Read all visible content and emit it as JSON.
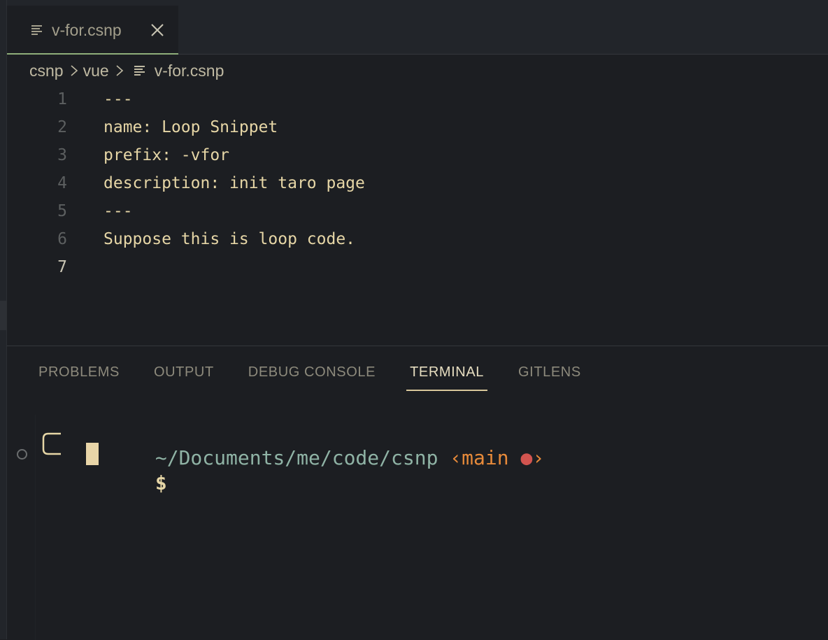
{
  "tab": {
    "label": "v-for.csnp",
    "file_icon": "lines-file-icon",
    "close_icon": "close-icon"
  },
  "breadcrumb": {
    "items": [
      "csnp",
      "vue",
      "v-for.csnp"
    ]
  },
  "editor": {
    "lines": [
      {
        "num": "1",
        "text": "---"
      },
      {
        "num": "2",
        "text": "name: Loop Snippet"
      },
      {
        "num": "3",
        "text": "prefix: -vfor"
      },
      {
        "num": "4",
        "text": "description: init taro page"
      },
      {
        "num": "5",
        "text": "---"
      },
      {
        "num": "6",
        "text": "Suppose this is loop code."
      },
      {
        "num": "7",
        "text": ""
      }
    ],
    "current_line": 7
  },
  "panel": {
    "tabs": [
      "PROBLEMS",
      "OUTPUT",
      "DEBUG CONSOLE",
      "TERMINAL",
      "GITLENS"
    ],
    "active_tab": "TERMINAL"
  },
  "terminal": {
    "path": "~/Documents/me/code/csnp",
    "branch_open": "‹",
    "branch": "main",
    "dirty_indicator": "●",
    "branch_close": "›",
    "prompt_symbol": "$"
  },
  "colors": {
    "background": "#1c1e22",
    "text": "#e6d6a6",
    "path": "#8fb3a5",
    "branch": "#e78a3a",
    "dirty": "#d2544f",
    "active_tab_underline": "#8fae7a"
  }
}
